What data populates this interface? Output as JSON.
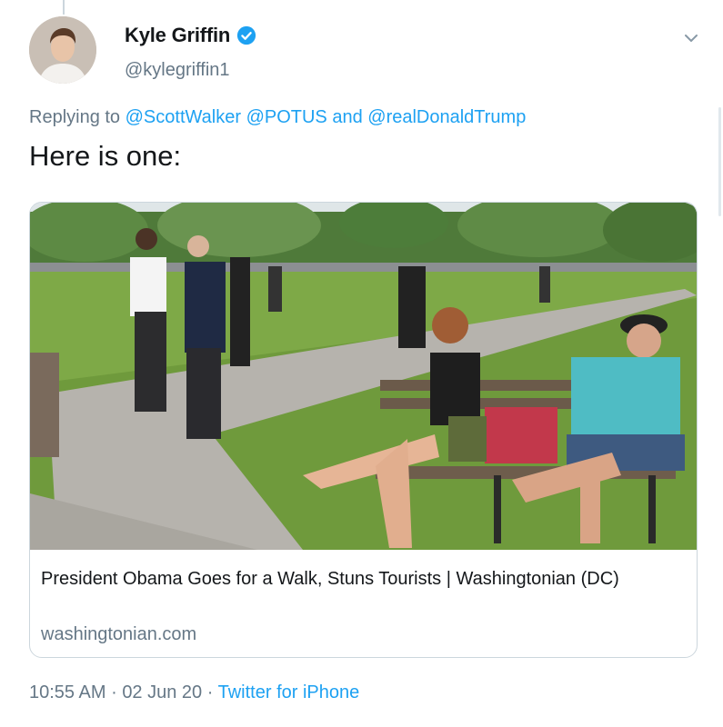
{
  "tweet": {
    "author_name": "Kyle Griffin",
    "author_handle": "@kylegriffin1",
    "replying_prefix": "Replying to",
    "replying_mentions": [
      "@ScottWalker",
      "@POTUS",
      "@realDonaldTrump"
    ],
    "replying_and": "and",
    "text": "Here is one:",
    "time": "10:55 AM",
    "date": "02 Jun 20",
    "separator": "·",
    "source": "Twitter for iPhone"
  },
  "link_card": {
    "title": "President Obama Goes for a Walk, Stuns Tourists | Washingtonian (DC)",
    "domain": "washingtonian.com"
  },
  "icons": {
    "verified": "verified-badge-icon",
    "menu": "chevron-down-icon"
  },
  "colors": {
    "link": "#1da1f2",
    "secondary_text": "#657786",
    "primary_text": "#14171a",
    "border": "#ccd6dd"
  }
}
